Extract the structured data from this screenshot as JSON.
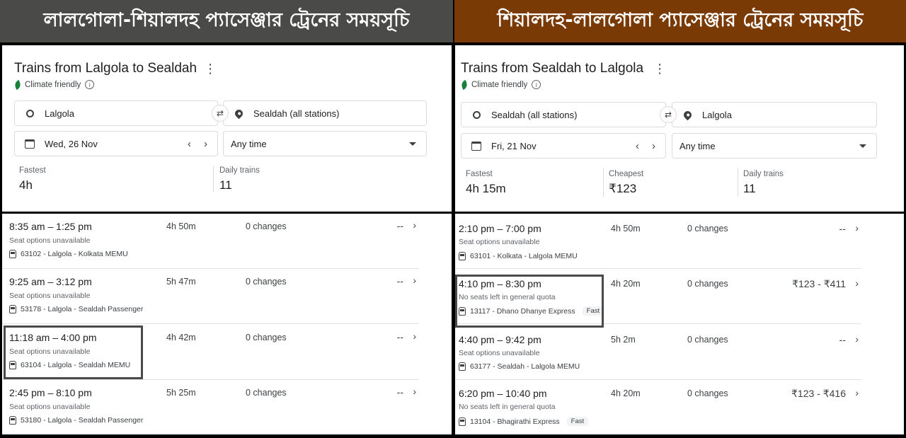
{
  "left": {
    "banner": "লালগোলা-শিয়ালদহ প্যাসেঞ্জার ট্রেনের সময়সূচি",
    "title": "Trains from Lalgola to Sealdah",
    "climate": "Climate friendly",
    "origin": "Lalgola",
    "destination": "Sealdah (all stations)",
    "date": "Wed, 26 Nov",
    "time_select": "Any time",
    "stats": [
      {
        "label": "Fastest",
        "value": "4h"
      },
      {
        "label": "Daily trains",
        "value": "11"
      }
    ],
    "trains": [
      {
        "time": "8:35 am – 1:25 pm",
        "seat": "Seat options unavailable",
        "train": "63102 - Lalgola - Kolkata MEMU",
        "badge": "",
        "duration": "4h 50m",
        "changes": "0 changes",
        "price": "--"
      },
      {
        "time": "9:25 am – 3:12 pm",
        "seat": "Seat options unavailable",
        "train": "53178 - Lalgola - Sealdah Passenger",
        "badge": "",
        "duration": "5h 47m",
        "changes": "0 changes",
        "price": "--"
      },
      {
        "time": "11:18 am – 4:00 pm",
        "seat": "Seat options unavailable",
        "train": "63104 - Lalgola - Sealdah MEMU",
        "badge": "",
        "duration": "4h 42m",
        "changes": "0 changes",
        "price": "--"
      },
      {
        "time": "2:45 pm – 8:10 pm",
        "seat": "Seat options unavailable",
        "train": "53180 - Lalgola - Sealdah Passenger",
        "badge": "",
        "duration": "5h 25m",
        "changes": "0 changes",
        "price": "--"
      }
    ]
  },
  "right": {
    "banner": "শিয়ালদহ-লালগোলা প্যাসেঞ্জার ট্রেনের সময়সূচি",
    "title": "Trains from Sealdah to Lalgola",
    "climate": "Climate friendly",
    "origin": "Sealdah (all stations)",
    "destination": "Lalgola",
    "date": "Fri, 21 Nov",
    "time_select": "Any time",
    "stats": [
      {
        "label": "Fastest",
        "value": "4h 15m"
      },
      {
        "label": "Cheapest",
        "value": "₹123"
      },
      {
        "label": "Daily trains",
        "value": "11"
      }
    ],
    "trains": [
      {
        "time": "2:10 pm – 7:00 pm",
        "seat": "Seat options unavailable",
        "train": "63101 - Kolkata - Lalgola MEMU",
        "badge": "",
        "duration": "4h 50m",
        "changes": "0 changes",
        "price": "--"
      },
      {
        "time": "4:10 pm – 8:30 pm",
        "seat": "No seats left in general quota",
        "train": "13117 - Dhano Dhanye Express",
        "badge": "Fast",
        "duration": "4h 20m",
        "changes": "0 changes",
        "price": "₹123 - ₹411"
      },
      {
        "time": "4:40 pm – 9:42 pm",
        "seat": "Seat options unavailable",
        "train": "63177 - Sealdah - Lalgola MEMU",
        "badge": "",
        "duration": "5h 2m",
        "changes": "0 changes",
        "price": "--"
      },
      {
        "time": "6:20 pm – 10:40 pm",
        "seat": "No seats left in general quota",
        "train": "13104 - Bhagirathi Express",
        "badge": "Fast",
        "duration": "4h 20m",
        "changes": "0 changes",
        "price": "₹123 - ₹416"
      }
    ]
  },
  "icons": {
    "chevron_right": "›",
    "chevron_left": "‹",
    "swap": "⇄",
    "kebab": "⋮",
    "info": "i"
  }
}
